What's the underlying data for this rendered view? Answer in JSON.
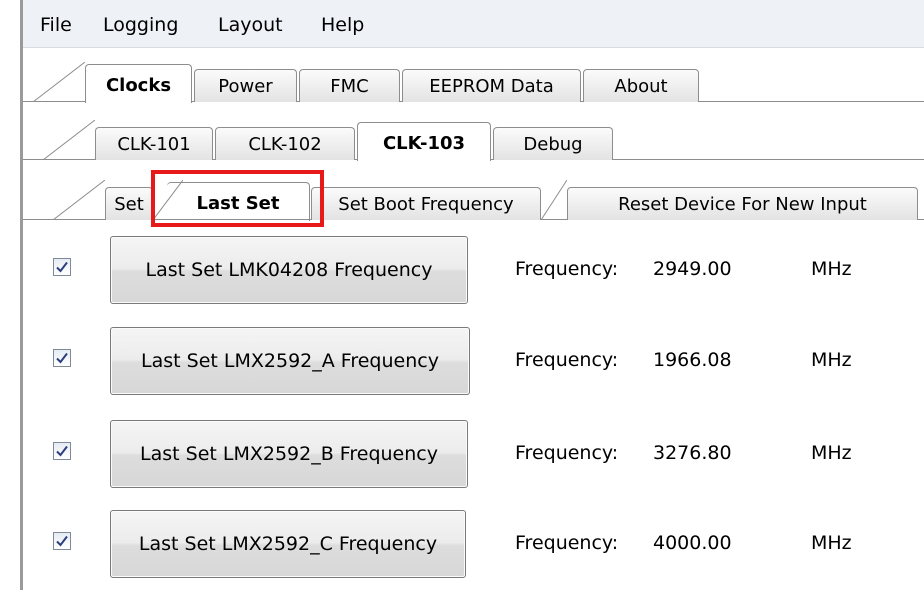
{
  "menu": {
    "file": "File",
    "logging": "Logging",
    "layout": "Layout",
    "help": "Help"
  },
  "main_tabs": [
    {
      "label": "Clocks",
      "active": true
    },
    {
      "label": "Power",
      "active": false
    },
    {
      "label": "FMC",
      "active": false
    },
    {
      "label": "EEPROM Data",
      "active": false
    },
    {
      "label": "About",
      "active": false
    }
  ],
  "clock_tabs": [
    {
      "label": "CLK-101",
      "active": false
    },
    {
      "label": "CLK-102",
      "active": false
    },
    {
      "label": "CLK-103",
      "active": true
    },
    {
      "label": "Debug",
      "active": false
    }
  ],
  "action_tabs": [
    {
      "label": "Set",
      "active": false
    },
    {
      "label": "Last Set",
      "active": true
    },
    {
      "label": "Set Boot Frequency",
      "active": false
    },
    {
      "label": "Reset Device For New Input",
      "active": false
    }
  ],
  "highlight_color": "#e8191b",
  "rows": [
    {
      "checked": true,
      "button_label": "Last Set LMK04208 Frequency",
      "freq_label": "Frequency:",
      "freq_value": "2949.00",
      "unit": "MHz"
    },
    {
      "checked": true,
      "button_label": "Last Set LMX2592_A Frequency",
      "freq_label": "Frequency:",
      "freq_value": "1966.08",
      "unit": "MHz"
    },
    {
      "checked": true,
      "button_label": "Last Set LMX2592_B Frequency",
      "freq_label": "Frequency:",
      "freq_value": "3276.80",
      "unit": "MHz"
    },
    {
      "checked": true,
      "button_label": "Last Set LMX2592_C Frequency",
      "freq_label": "Frequency:",
      "freq_value": "4000.00",
      "unit": "MHz"
    }
  ]
}
